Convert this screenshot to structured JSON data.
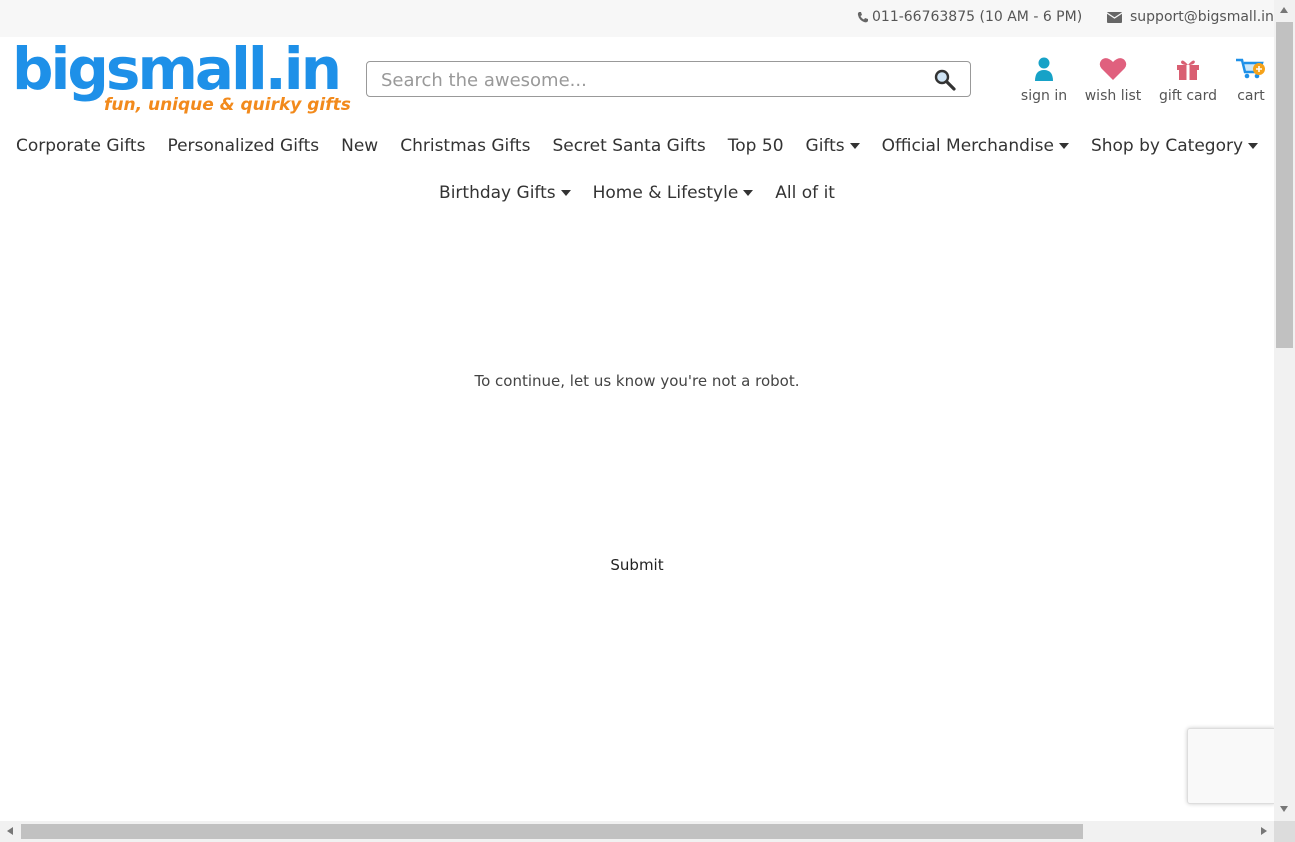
{
  "topbar": {
    "phone": "011-66763875 (10 AM - 6 PM)",
    "email": "support@bigsmall.in"
  },
  "logo": {
    "brand": "bigsmall.in",
    "tagline": "fun, unique & quirky gifts"
  },
  "search": {
    "placeholder": "Search the awesome..."
  },
  "account": {
    "sign_in": "sign in",
    "wish_list": "wish list",
    "gift_card": "gift card",
    "cart": "cart"
  },
  "nav_row1": [
    {
      "label": "Corporate Gifts"
    },
    {
      "label": "Personalized Gifts"
    },
    {
      "label": "New"
    },
    {
      "label": "Christmas Gifts"
    },
    {
      "label": "Secret Santa Gifts"
    },
    {
      "label": "Top 50"
    },
    {
      "label": "Gifts"
    },
    {
      "label": "Official Merchandise"
    },
    {
      "label": "Shop by Category"
    }
  ],
  "nav_row2": [
    {
      "label": "Birthday Gifts"
    },
    {
      "label": "Home & Lifestyle"
    },
    {
      "label": "All of it"
    }
  ],
  "main": {
    "message": "To continue, let us know you're not a robot.",
    "submit_label": "Submit"
  },
  "colors": {
    "brand_blue": "#1e90e8",
    "brand_orange": "#f28a1c",
    "user_icon": "#17a2c7",
    "heart_icon": "#e0607e",
    "gift_icon": "#d95f72"
  },
  "icons": [
    "phone-icon",
    "envelope-icon",
    "search-icon",
    "user-icon",
    "heart-icon",
    "gift-icon",
    "cart-icon"
  ]
}
